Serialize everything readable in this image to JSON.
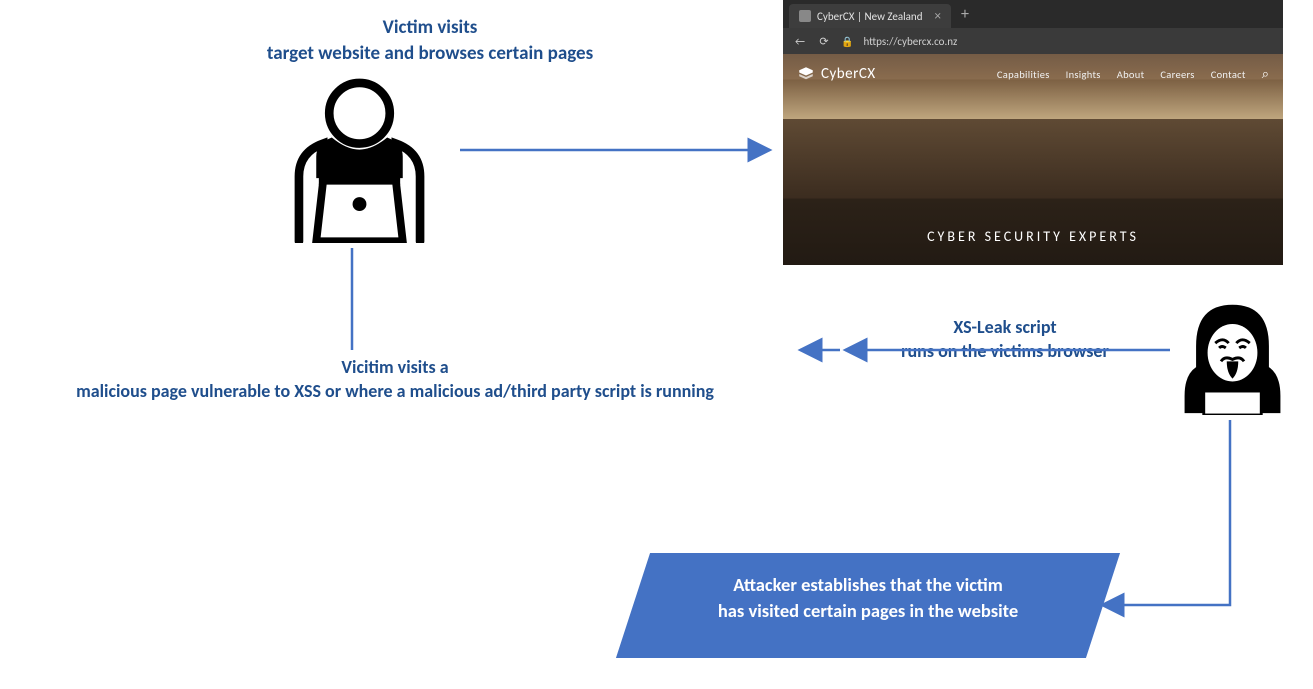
{
  "labels": {
    "top_line1": "Victim visits",
    "top_line2": "target website and browses certain pages",
    "mid_line1": "Vicitim visits a",
    "mid_line2": "malicious page vulnerable to XSS or where a malicious ad/third party script is running",
    "xs_line1": "XS-Leak script",
    "xs_line2": "runs on the victims browser",
    "result_line1": "Attacker establishes that the victim",
    "result_line2": "has visited certain pages in the website"
  },
  "browser": {
    "tab_title": "CyberCX | New Zealand",
    "tab_close": "×",
    "tab_plus": "+",
    "back_icon": "←",
    "refresh_icon": "⟳",
    "lock_icon": "🔒",
    "url": "https://cybercx.co.nz",
    "logo_text": "CyberCX",
    "nav": {
      "capabilities": "Capabilities",
      "insights": "Insights",
      "about": "About",
      "careers": "Careers",
      "contact": "Contact"
    },
    "search_icon": "⌕",
    "hero": "CYBER SECURITY EXPERTS"
  },
  "colors": {
    "label_blue": "#1f4e8c",
    "box_blue": "#4472c4",
    "arrow_blue": "#4472c4"
  },
  "icons": {
    "victim": "user-laptop-icon",
    "attacker": "hooded-hacker-icon"
  }
}
